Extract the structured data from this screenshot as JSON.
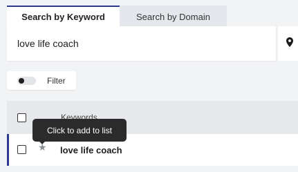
{
  "tabs": [
    {
      "label": "Search by Keyword",
      "active": true
    },
    {
      "label": "Search by Domain",
      "active": false
    }
  ],
  "search": {
    "value": "love life coach",
    "location_icon": "map-pin-icon"
  },
  "filter": {
    "label": "Filter",
    "enabled": false
  },
  "table": {
    "columns": [
      "Keywords"
    ],
    "rows": [
      {
        "keyword": "love life coach",
        "star_icon": "star-icon"
      }
    ]
  },
  "tooltip": {
    "text": "Click to add to list"
  },
  "colors": {
    "accent": "#2b3a8f",
    "background": "#f2f3f5",
    "tooltip": "#2b2b2b"
  }
}
